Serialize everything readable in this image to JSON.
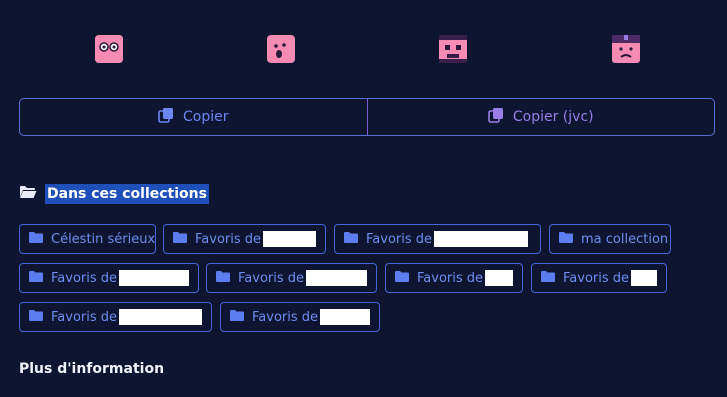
{
  "reactions": [
    {
      "icon": "googly-eyes-face-icon"
    },
    {
      "icon": "surprised-face-icon"
    },
    {
      "icon": "robot-face-icon"
    },
    {
      "icon": "sad-face-icon"
    }
  ],
  "copy": {
    "copy_label": "Copier",
    "copy_jvc_label": "Copier (jvc)"
  },
  "collections": {
    "title": "Dans ces collections",
    "tags": [
      {
        "label": "Célestin sérieux"
      },
      {
        "label": "Favoris de"
      },
      {
        "label": "Favoris de"
      },
      {
        "label": "ma collection"
      },
      {
        "label": "Favoris de"
      },
      {
        "label": "Favoris de"
      },
      {
        "label": "Favoris de"
      },
      {
        "label": "Favoris de"
      },
      {
        "label": "Favoris de"
      },
      {
        "label": "Favoris de"
      }
    ]
  },
  "more_info": {
    "title": "Plus d'information"
  },
  "colors": {
    "background": "#0d1530",
    "accent_blue": "#6c86f2",
    "accent_purple": "#9a7ce6",
    "emoji_pink": "#f58ab2",
    "highlight": "#1f4fb8"
  }
}
